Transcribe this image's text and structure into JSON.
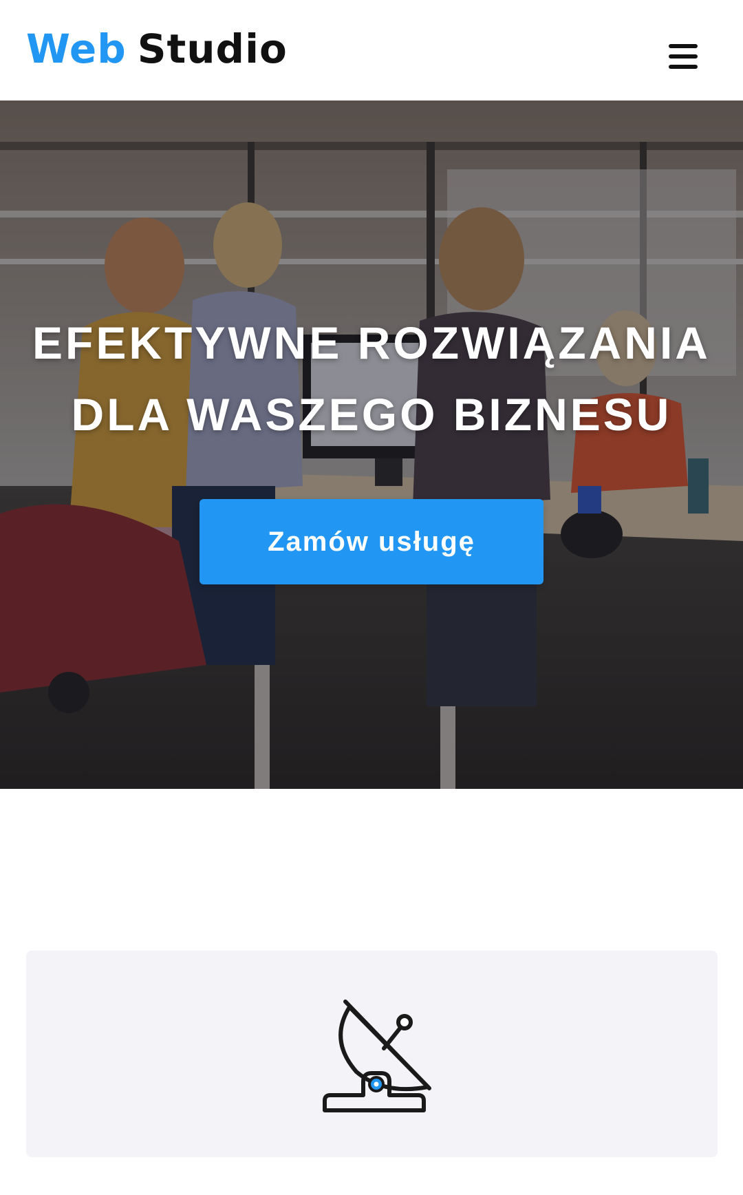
{
  "header": {
    "logo_part_a": "Web",
    "logo_part_b": "Studio",
    "menu_icon": "hamburger-menu-icon"
  },
  "hero": {
    "title_line_1": "EFEKTYWNE ROZWIĄZANIA",
    "title_line_2": "DLA WASZEGO BIZNESU",
    "cta_label": "Zamów usługę"
  },
  "features": {
    "card_1_icon": "satellite-dish-icon"
  },
  "colors": {
    "accent": "#2196f3",
    "text_dark": "#111111",
    "card_bg": "#f4f4f8"
  }
}
